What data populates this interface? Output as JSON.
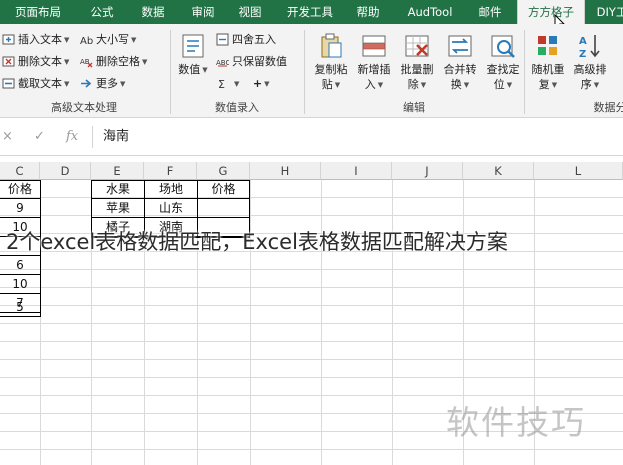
{
  "tabs": [
    {
      "label": "页面布局"
    },
    {
      "label": "公式"
    },
    {
      "label": "数据"
    },
    {
      "label": "审阅"
    },
    {
      "label": "视图"
    },
    {
      "label": "开发工具"
    },
    {
      "label": "帮助"
    },
    {
      "label": "AudTool"
    },
    {
      "label": "邮件"
    },
    {
      "label": "方方格子"
    },
    {
      "label": "DIY工"
    }
  ],
  "ribbon": {
    "text_group": {
      "items": [
        {
          "label": "插入文本"
        },
        {
          "label": "删除文本"
        },
        {
          "label": "截取文本"
        }
      ],
      "label": "高级文本处理"
    },
    "case_group": {
      "items": [
        {
          "label": "大小写"
        },
        {
          "label": "删除空格"
        },
        {
          "label": "更多"
        }
      ]
    },
    "number_group": {
      "big_label": "数值",
      "items": [
        {
          "label": "四舍五入"
        },
        {
          "label": "只保留数值"
        },
        {
          "label": "+"
        }
      ],
      "label": "数值录入"
    },
    "edit_group": {
      "buttons": [
        {
          "line1": "复制粘",
          "line2": "贴"
        },
        {
          "line1": "新增插",
          "line2": "入"
        },
        {
          "line1": "批量删",
          "line2": "除"
        },
        {
          "line1": "合并转",
          "line2": "换"
        },
        {
          "line1": "查找定",
          "line2": "位"
        }
      ],
      "label": "编辑"
    },
    "data_group": {
      "buttons": [
        {
          "line1": "随机重",
          "line2": "复"
        },
        {
          "line1": "高级排",
          "line2": "序"
        }
      ],
      "label": "数据分"
    }
  },
  "formula_bar": {
    "cancel": "×",
    "confirm": "✓",
    "fx": "fx",
    "value": "海南"
  },
  "columns": [
    "C",
    "D",
    "E",
    "F",
    "G",
    "H",
    "I",
    "J",
    "K",
    "L"
  ],
  "table_left": {
    "header": "价格",
    "values": [
      "9",
      "10",
      "",
      "6",
      "10",
      "7",
      "5"
    ]
  },
  "table_right": {
    "headers": [
      "水果",
      "场地",
      "价格"
    ],
    "rows": [
      [
        "苹果",
        "山东",
        ""
      ],
      [
        "橘子",
        "湖南",
        ""
      ]
    ]
  },
  "caption": "2个excel表格数据匹配，Excel表格数据匹配解决方案",
  "watermark": "软件技巧"
}
